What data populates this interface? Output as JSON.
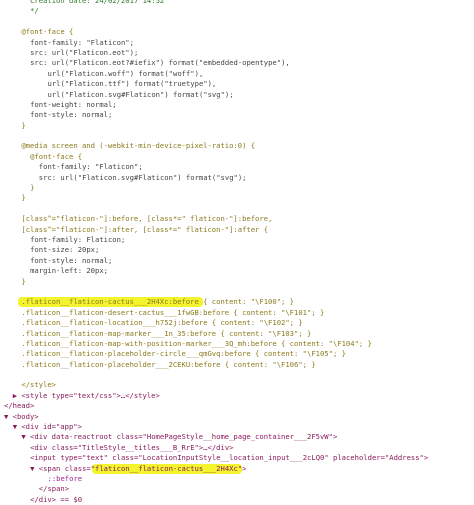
{
  "lines": [
    {
      "indent": 6,
      "cls": "cmt",
      "text": "Creation date: 24/02/2017 14:52"
    },
    {
      "indent": 6,
      "cls": "cmt",
      "text": "*/"
    },
    {
      "indent": 0,
      "cls": "pln",
      "text": ""
    },
    {
      "indent": 4,
      "cls": "sel",
      "text": "@font-face {"
    },
    {
      "indent": 6,
      "cls": "pln",
      "text": "font-family: \"Flaticon\";"
    },
    {
      "indent": 6,
      "cls": "pln",
      "text": "src: url(\"Flaticon.eot\");"
    },
    {
      "indent": 6,
      "cls": "pln",
      "text": "src: url(\"Flaticon.eot?#iefix\") format(\"embedded-opentype\"),"
    },
    {
      "indent": 10,
      "cls": "pln",
      "text": "url(\"Flaticon.woff\") format(\"woff\"),"
    },
    {
      "indent": 10,
      "cls": "pln",
      "text": "url(\"Flaticon.ttf\") format(\"truetype\"),"
    },
    {
      "indent": 10,
      "cls": "pln",
      "text": "url(\"Flaticon.svg#Flaticon\") format(\"svg\");"
    },
    {
      "indent": 6,
      "cls": "pln",
      "text": "font-weight: normal;"
    },
    {
      "indent": 6,
      "cls": "pln",
      "text": "font-style: normal;"
    },
    {
      "indent": 4,
      "cls": "sel",
      "text": "}"
    },
    {
      "indent": 0,
      "cls": "pln",
      "text": ""
    },
    {
      "indent": 4,
      "cls": "sel",
      "text": "@media screen and (-webkit-min-device-pixel-ratio:0) {"
    },
    {
      "indent": 6,
      "cls": "sel",
      "text": "@font-face {"
    },
    {
      "indent": 8,
      "cls": "pln",
      "text": "font-family: \"Flaticon\";"
    },
    {
      "indent": 8,
      "cls": "pln",
      "text": "src: url(\"Flaticon.svg#Flaticon\") format(\"svg\");"
    },
    {
      "indent": 6,
      "cls": "sel",
      "text": "}"
    },
    {
      "indent": 4,
      "cls": "sel",
      "text": "}"
    },
    {
      "indent": 0,
      "cls": "pln",
      "text": ""
    },
    {
      "indent": 4,
      "cls": "sel",
      "text": "[class^=\"flaticon-\"]:before, [class*=\" flaticon-\"]:before,"
    },
    {
      "indent": 4,
      "cls": "sel",
      "text": "[class^=\"flaticon-\"]:after, [class*=\" flaticon-\"]:after {"
    },
    {
      "indent": 6,
      "cls": "pln",
      "text": "font-family: Flaticon;"
    },
    {
      "indent": 6,
      "cls": "pln",
      "text": "font-size: 20px;"
    },
    {
      "indent": 6,
      "cls": "pln",
      "text": "font-style: normal;"
    },
    {
      "indent": 6,
      "cls": "pln",
      "text": "margin-left: 20px;"
    },
    {
      "indent": 4,
      "cls": "sel",
      "text": "}"
    },
    {
      "indent": 0,
      "cls": "pln",
      "text": ""
    },
    {
      "indent": 4,
      "cls": "sel",
      "text": ".flaticon__flaticon-cactus___2H4Xc:before { content: \"\\F100\"; }",
      "mark": true
    },
    {
      "indent": 4,
      "cls": "sel",
      "text": ".flaticon__flaticon-desert-cactus___1fwGB:before { content: \"\\F101\"; }"
    },
    {
      "indent": 4,
      "cls": "sel",
      "text": ".flaticon__flaticon-location___h752j:before { content: \"\\F102\"; }"
    },
    {
      "indent": 4,
      "cls": "sel",
      "text": ".flaticon__flaticon-map-marker___1n_35:before { content: \"\\F103\"; }"
    },
    {
      "indent": 4,
      "cls": "sel",
      "text": ".flaticon__flaticon-map-with-position-marker___3Q_mh:before { content: \"\\F104\"; }"
    },
    {
      "indent": 4,
      "cls": "sel",
      "text": ".flaticon__flaticon-placeholder-circle___qmGvq:before { content: \"\\F105\"; }"
    },
    {
      "indent": 4,
      "cls": "sel",
      "text": ".flaticon__flaticon-placeholder___2CEKU:before { content: \"\\F106\"; }"
    },
    {
      "indent": 0,
      "cls": "pln",
      "text": ""
    },
    {
      "indent": 4,
      "cls": "sel",
      "text": "</style>"
    },
    {
      "indent": 2,
      "cls": "tag",
      "text": "▶ <style type=\"text/css\">…</style>"
    },
    {
      "indent": 0,
      "cls": "tag",
      "text": "</head>"
    },
    {
      "indent": 0,
      "cls": "tag",
      "text": "▼ <body>"
    },
    {
      "indent": 2,
      "cls": "tag",
      "text": "▼ <div id=\"app\">"
    },
    {
      "indent": 4,
      "cls": "tag",
      "text": "▼ <div data-reactroot class=\"HomePageStyle__home_page_container___2F5vW\">"
    },
    {
      "indent": 6,
      "cls": "tag",
      "text": "<div class=\"TitleStyle__titles___B_RrE\">…</div>"
    },
    {
      "indent": 6,
      "cls": "tag",
      "text": "<input type=\"text\" class=\"LocationInputStyle__location_input___2cLQ0\" placeholder=\"Address\">"
    },
    {
      "indent": 6,
      "cls": "tag",
      "text": "▼ <span class=\"flaticon__flaticon-cactus___2H4Xc\">",
      "mark": true
    },
    {
      "indent": 10,
      "cls": "kw",
      "text": "::before"
    },
    {
      "indent": 8,
      "cls": "tag",
      "text": "</span>"
    },
    {
      "indent": 6,
      "cls": "tag",
      "text": "</div> == $0"
    }
  ],
  "highlight_color": "#f2f21c"
}
